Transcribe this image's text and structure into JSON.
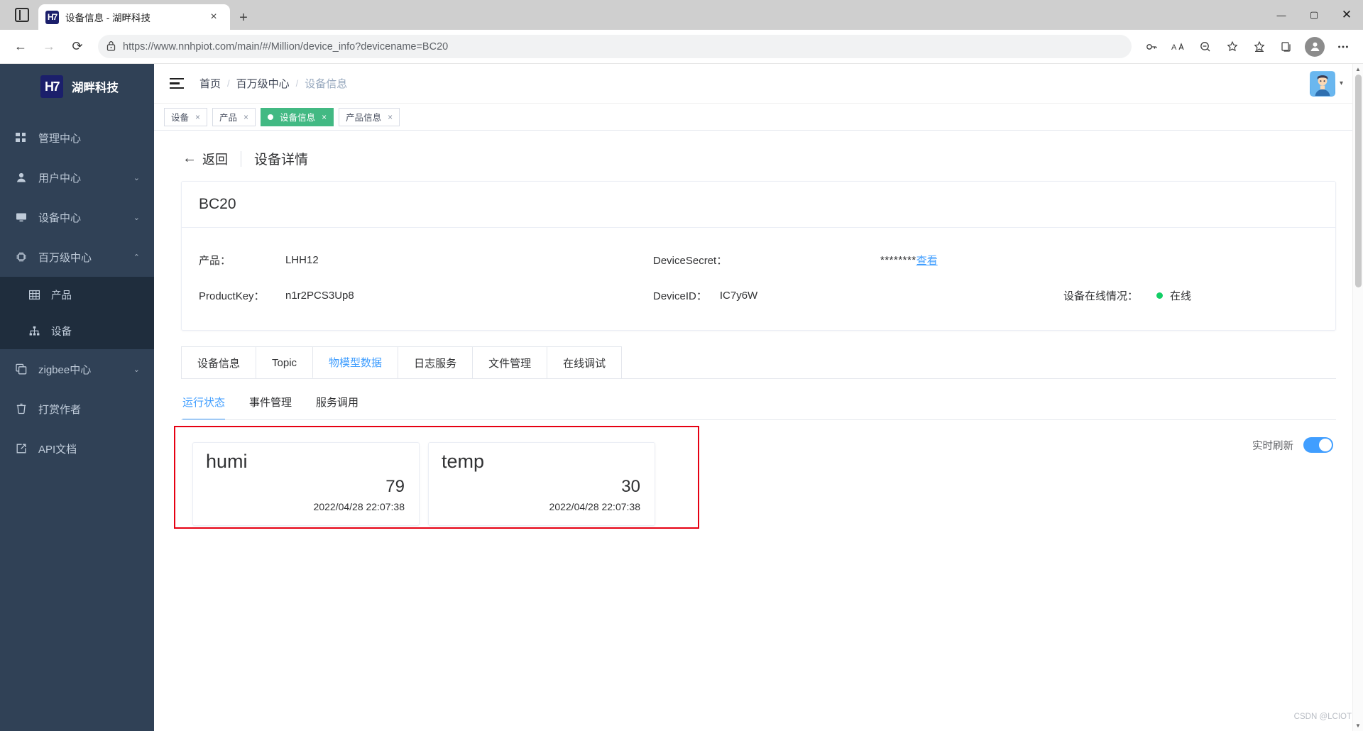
{
  "browser": {
    "tab": {
      "title": "设备信息 - 湖畔科技",
      "favicon_text": "H7",
      "close_icon": "×"
    },
    "new_tab_icon": "+",
    "tab_list_icon": "tab-list",
    "window": {
      "minimize": "—",
      "maximize": "▢",
      "close": "✕"
    },
    "nav": {
      "back": "←",
      "forward": "→",
      "reload": "⟳"
    },
    "address": {
      "lock_icon": "lock",
      "scheme": "https://",
      "host": "www.nnhpiot.com",
      "path": "/main/#/Million/device_info?devicename=BC20",
      "full_url": "https://www.nnhpiot.com/main/#/Million/device_info?devicename=BC20"
    },
    "toolbar_icons": [
      "key-icon",
      "read-aloud-icon",
      "zoom-out-icon",
      "add-favorite-icon",
      "favorites-icon",
      "collections-icon",
      "profile-icon",
      "settings-more-icon"
    ]
  },
  "sidebar": {
    "brand": {
      "logo_text": "H7",
      "name": "湖畔科技"
    },
    "items": [
      {
        "label": "管理中心",
        "icon": "dashboard-icon",
        "arrow": ""
      },
      {
        "label": "用户中心",
        "icon": "user-icon",
        "arrow": "⌄"
      },
      {
        "label": "设备中心",
        "icon": "monitor-icon",
        "arrow": "⌄"
      },
      {
        "label": "百万级中心",
        "icon": "chip-icon",
        "arrow": "⌃"
      }
    ],
    "submenu": [
      {
        "label": "产品",
        "icon": "table-icon"
      },
      {
        "label": "设备",
        "icon": "sitemap-icon"
      }
    ],
    "items_after": [
      {
        "label": "zigbee中心",
        "icon": "copy-icon",
        "arrow": "⌄"
      },
      {
        "label": "打赏作者",
        "icon": "cup-icon",
        "arrow": ""
      },
      {
        "label": "API文档",
        "icon": "external-link-icon",
        "arrow": ""
      }
    ]
  },
  "topbar": {
    "hamburger_icon": "hamburger-icon",
    "breadcrumb": [
      {
        "label": "首页",
        "muted": false
      },
      {
        "label": "百万级中心",
        "muted": false
      },
      {
        "label": "设备信息",
        "muted": true
      }
    ],
    "separator": "/",
    "avatar_icon": "user-avatar",
    "caret": "▾"
  },
  "tags_view": [
    {
      "label": "设备",
      "active": false,
      "close": "×"
    },
    {
      "label": "产品",
      "active": false,
      "close": "×"
    },
    {
      "label": "设备信息",
      "active": true,
      "close": "×"
    },
    {
      "label": "产品信息",
      "active": false,
      "close": "×"
    }
  ],
  "page": {
    "back_label": "返回",
    "back_arrow": "←",
    "title": "设备详情",
    "device_name": "BC20",
    "fields": {
      "product_label": "产品：",
      "product_value": "LHH12",
      "product_key_label": "ProductKey：",
      "product_key_value": "n1r2PCS3Up8",
      "device_secret_label": "DeviceSecret：",
      "device_secret_value": "********",
      "device_secret_action": "查看",
      "device_id_label": "DeviceID：",
      "device_id_value": "IC7y6W",
      "online_label": "设备在线情况：",
      "online_status": "在线",
      "online_color": "#13ce66"
    }
  },
  "tabs": [
    {
      "label": "设备信息",
      "active": false
    },
    {
      "label": "Topic",
      "active": false
    },
    {
      "label": "物模型数据",
      "active": true
    },
    {
      "label": "日志服务",
      "active": false
    },
    {
      "label": "文件管理",
      "active": false
    },
    {
      "label": "在线调试",
      "active": false
    }
  ],
  "subtabs": [
    {
      "label": "运行状态",
      "active": true
    },
    {
      "label": "事件管理",
      "active": false
    },
    {
      "label": "服务调用",
      "active": false
    }
  ],
  "realtime": {
    "label": "实时刷新",
    "enabled": true,
    "color": "#409eff"
  },
  "properties": [
    {
      "name": "humi",
      "value": "79",
      "time": "2022/04/28 22:07:38"
    },
    {
      "name": "temp",
      "value": "30",
      "time": "2022/04/28 22:07:38"
    }
  ],
  "highlight_color": "#e60012",
  "watermark": "CSDN @LCIOT",
  "scrollbar": {
    "up": "▲",
    "down": "▼"
  }
}
